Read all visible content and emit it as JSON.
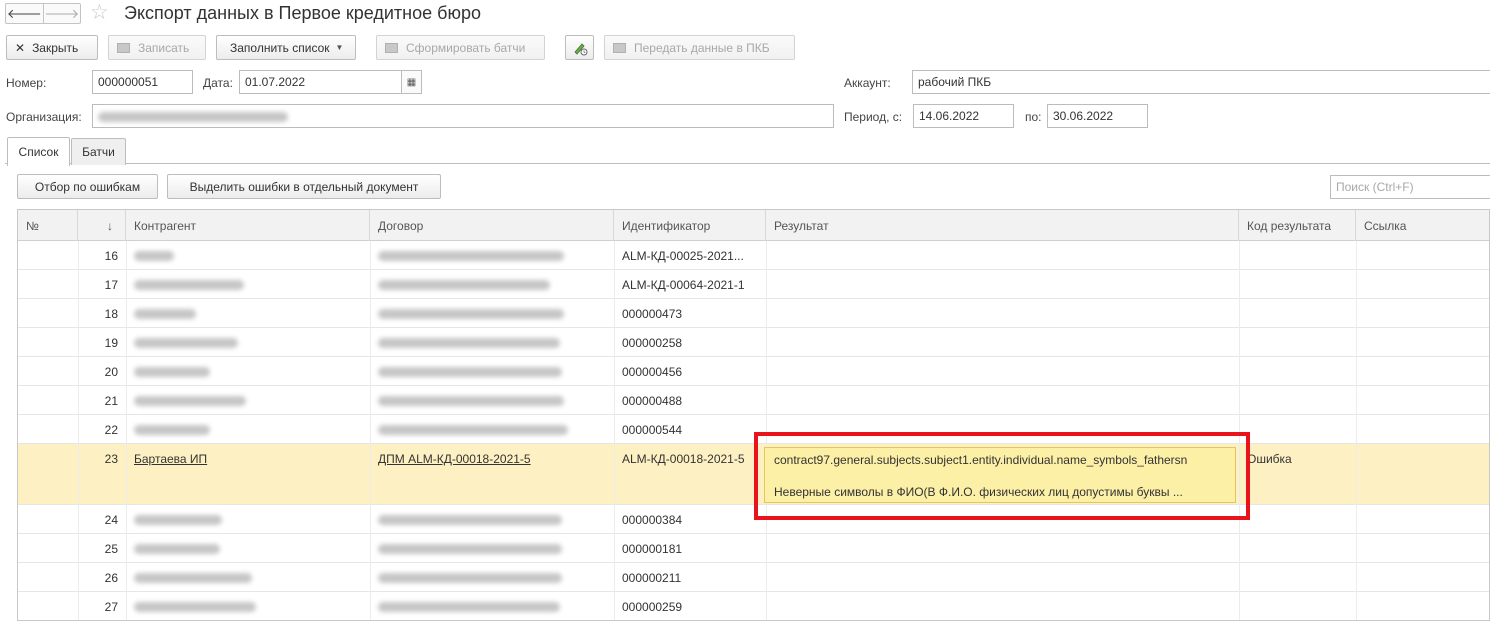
{
  "window": {
    "title": "Экспорт данных в Первое кредитное бюро",
    "back_glyph": "🡐",
    "forward_glyph": "🡒",
    "star_glyph": "☆"
  },
  "toolbar": {
    "close_label": "Закрыть",
    "close_glyph": "✕",
    "save_label": "Записать",
    "fill_label": "Заполнить список",
    "caret_glyph": "▼",
    "form_batches_label": "Сформировать батчи",
    "send_label": "Передать данные в ПКБ"
  },
  "form": {
    "number_label": "Номер:",
    "number_value": "000000051",
    "date_label": "Дата:",
    "date_value": "01.07.2022",
    "calendar_glyph": "▦",
    "org_label": "Организация:",
    "account_label": "Аккаунт:",
    "account_value": "рабочий ПКБ",
    "period_label": "Период, с:",
    "period_from": "14.06.2022",
    "period_to_label": "по:",
    "period_to": "30.06.2022"
  },
  "tabs": [
    {
      "label": "Список",
      "active": true
    },
    {
      "label": "Батчи",
      "active": false
    }
  ],
  "list_toolbar": {
    "filter_errors_label": "Отбор по ошибкам",
    "extract_errors_label": "Выделить ошибки в отдельный документ",
    "search_placeholder": "Поиск (Ctrl+F)"
  },
  "table": {
    "headers": {
      "num": "№",
      "sort_glyph": "↓",
      "counterparty": "Контрагент",
      "contract": "Договор",
      "identifier": "Идентификатор",
      "result": "Результат",
      "result_code": "Код результата",
      "link": "Ссылка"
    },
    "rows": [
      {
        "n": "16",
        "counterparty": "",
        "contract": "",
        "identifier": "ALM-КД-00025-2021...",
        "blurred": true
      },
      {
        "n": "17",
        "counterparty": "",
        "contract": "",
        "identifier": "ALM-КД-00064-2021-1",
        "blurred": true
      },
      {
        "n": "18",
        "counterparty": "",
        "contract": "",
        "identifier": "000000473",
        "blurred": true
      },
      {
        "n": "19",
        "counterparty": "",
        "contract": "",
        "identifier": "000000258",
        "blurred": true
      },
      {
        "n": "20",
        "counterparty": "",
        "contract": "",
        "identifier": "000000456",
        "blurred": true
      },
      {
        "n": "21",
        "counterparty": "",
        "contract": "",
        "identifier": "000000488",
        "blurred": true
      },
      {
        "n": "22",
        "counterparty": "",
        "contract": "",
        "identifier": "000000544",
        "blurred": true
      },
      {
        "n": "23",
        "counterparty": "Бартаева ИП",
        "contract": "ДПМ ALM-КД-00018-2021-5",
        "identifier": "ALM-КД-00018-2021-5",
        "result_code": "Ошибка",
        "blurred": false,
        "selected": true
      },
      {
        "n": "24",
        "counterparty": "",
        "contract": "",
        "identifier": "000000384",
        "blurred": true
      },
      {
        "n": "25",
        "counterparty": "",
        "contract": "",
        "identifier": "000000181",
        "blurred": true
      },
      {
        "n": "26",
        "counterparty": "",
        "contract": "",
        "identifier": "000000211",
        "blurred": true
      },
      {
        "n": "27",
        "counterparty": "",
        "contract": "",
        "identifier": "000000259",
        "blurred": true
      }
    ]
  },
  "result_popup": {
    "line1": "contract97.general.subjects.subject1.entity.individual.name_symbols_fathersn",
    "line2": "Неверные символы в ФИО(В Ф.И.О. физических лиц допустимы буквы ..."
  },
  "colors": {
    "selected_row": "#fdf1c4",
    "popup_bg": "#fcefa6",
    "highlight_border": "#e8131b"
  }
}
